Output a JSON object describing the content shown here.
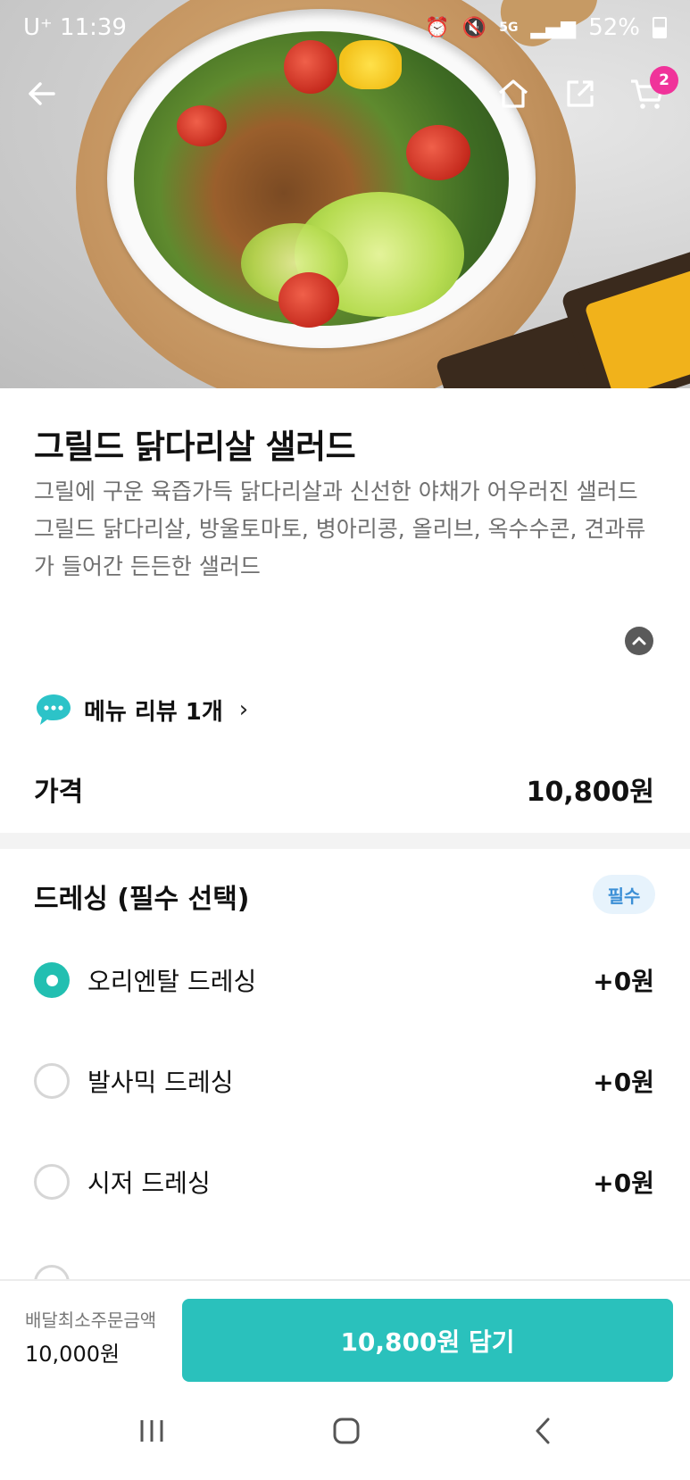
{
  "status_bar": {
    "carrier": "U⁺",
    "time": "11:39",
    "network": "5G",
    "battery": "52%"
  },
  "cart": {
    "badge_count": "2"
  },
  "menu": {
    "title": "그릴드 닭다리살 샐러드",
    "description_line1": "그릴에 구운 육즙가득 닭다리살과 신선한 야채가 어우러진 샐러드",
    "description_line2": "그릴드 닭다리살, 방울토마토, 병아리콩, 올리브, 옥수수콘, 견과류가 들어간 든든한 샐러드"
  },
  "review": {
    "label": "메뉴 리뷰 1개"
  },
  "price": {
    "label": "가격",
    "value": "10,800원"
  },
  "dressing": {
    "title": "드레싱 (필수 선택)",
    "badge": "필수",
    "options": [
      {
        "label": "오리엔탈 드레싱",
        "price": "+0원",
        "selected": true
      },
      {
        "label": "발사믹 드레싱",
        "price": "+0원",
        "selected": false
      },
      {
        "label": "시저 드레싱",
        "price": "+0원",
        "selected": false
      }
    ]
  },
  "bottom": {
    "min_order_label": "배달최소주문금액",
    "min_order_value": "10,000원",
    "cta_label": "10,800원 담기"
  },
  "colors": {
    "accent": "#2ac1bc",
    "radio_selected": "#22bfb1",
    "cart_badge": "#f0339a",
    "required_badge_text": "#3b8fd6"
  }
}
